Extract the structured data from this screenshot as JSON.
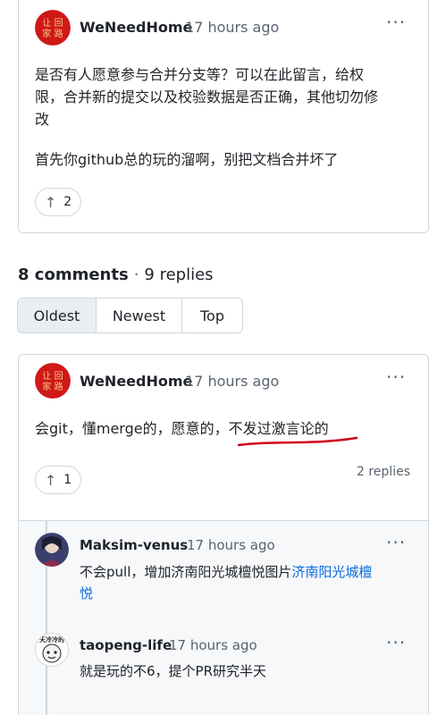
{
  "top_comment": {
    "author": "WeNeedHome",
    "time": "17 hours ago",
    "body_line1": "是否有人愿意参与合并分支等？可以在此留言，给权",
    "body_line2": "限，合并新的提交以及校验数据是否正确，其他切勿修",
    "body_line3": "改",
    "body_line4": "首先你github总的玩的溜啊，别把文档合并坏了",
    "reaction_count": "2",
    "kebab": "···"
  },
  "comments_header": {
    "comments": "8 comments",
    "separator": "·",
    "replies": "9 replies"
  },
  "sort_tabs": [
    {
      "label": "Oldest",
      "active": true
    },
    {
      "label": "Newest",
      "active": false
    },
    {
      "label": "Top",
      "active": false
    }
  ],
  "comment": {
    "author": "WeNeedHome",
    "time": "17 hours ago",
    "body_plain": "会git，懂merge的，愿意的，",
    "body_underlined": "不发过激言论的",
    "reaction_count": "1",
    "replies_count": "2 replies",
    "kebab": "···"
  },
  "replies": [
    {
      "author": "Maksim-venus",
      "time": "17 hours ago",
      "body_text": "不会pull，增加济南阳光城檀悦图片",
      "body_link1": "济南阳光城檀",
      "body_link2": "悦",
      "kebab": "···"
    },
    {
      "author": "taopeng-life",
      "time": "17 hours ago",
      "body_text": "就是玩的不6，提个PR研究半天",
      "avatar_text": "天冷冷的",
      "kebab": "···"
    }
  ],
  "colors": {
    "link": "#0969da",
    "underline_annotation": "#d0021b",
    "avatar_red": "#d01818",
    "border": "#d0d7de"
  },
  "icons": [
    "arrow-up-icon",
    "kebab-menu-icon"
  ]
}
